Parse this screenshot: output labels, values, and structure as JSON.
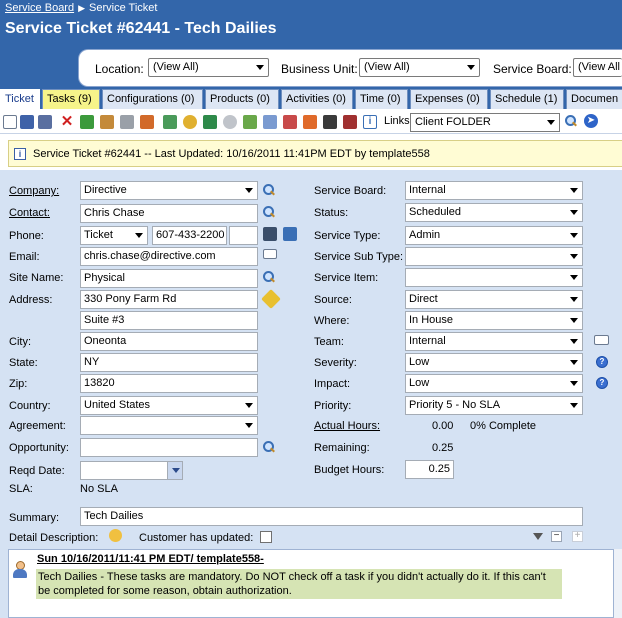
{
  "breadcrumb": {
    "parent": "Service Board",
    "current": "Service Ticket"
  },
  "title": "Service Ticket #62441 - Tech Dailies",
  "filters": {
    "location_label": "Location:",
    "location_value": "(View All)",
    "business_unit_label": "Business Unit:",
    "business_unit_value": "(View All)",
    "service_board_label": "Service Board:",
    "service_board_value": "(View All"
  },
  "tabs": [
    {
      "label": "Ticket"
    },
    {
      "label": "Tasks (9)"
    },
    {
      "label": "Configurations (0)"
    },
    {
      "label": "Products (0)"
    },
    {
      "label": "Activities (0)"
    },
    {
      "label": "Time (0)"
    },
    {
      "label": "Expenses (0)"
    },
    {
      "label": "Schedule (1)"
    },
    {
      "label": "Documen"
    }
  ],
  "toolbar": {
    "links_label": "Links:",
    "links_value": "Client FOLDER"
  },
  "info_message": "Service Ticket #62441 -- Last Updated: 10/16/2011 11:41PM EDT by template558",
  "form": {
    "company_label": "Company:",
    "company_value": "Directive",
    "contact_label": "Contact:",
    "contact_value": "Chris Chase",
    "phone_label": "Phone:",
    "phone_type": "Ticket",
    "phone_number": "607-433-2200",
    "phone_ext": "",
    "email_label": "Email:",
    "email_value": "chris.chase@directive.com",
    "site_label": "Site Name:",
    "site_value": "Physical",
    "address_label": "Address:",
    "address1": "330 Pony Farm Rd",
    "address2": "Suite #3",
    "city_label": "City:",
    "city_value": "Oneonta",
    "state_label": "State:",
    "state_value": "NY",
    "zip_label": "Zip:",
    "zip_value": "13820",
    "country_label": "Country:",
    "country_value": "United States",
    "agreement_label": "Agreement:",
    "agreement_value": "",
    "opportunity_label": "Opportunity:",
    "opportunity_value": "",
    "reqd_date_label": "Reqd Date:",
    "reqd_date_value": "",
    "sla_label": "SLA:",
    "sla_value": "No SLA",
    "service_board_label": "Service Board:",
    "service_board_value": "Internal",
    "status_label": "Status:",
    "status_value": "Scheduled",
    "service_type_label": "Service Type:",
    "service_type_value": "Admin",
    "service_subtype_label": "Service Sub Type:",
    "service_subtype_value": "",
    "service_item_label": "Service Item:",
    "service_item_value": "",
    "source_label": "Source:",
    "source_value": "Direct",
    "where_label": "Where:",
    "where_value": "In House",
    "team_label": "Team:",
    "team_value": "Internal",
    "severity_label": "Severity:",
    "severity_value": "Low",
    "impact_label": "Impact:",
    "impact_value": "Low",
    "priority_label": "Priority:",
    "priority_value": "Priority 5 - No SLA",
    "actual_hours_label": "Actual Hours:",
    "actual_hours_value": "0.00",
    "percent_complete": "0% Complete",
    "remaining_label": "Remaining:",
    "remaining_value": "0.25",
    "budget_hours_label": "Budget Hours:",
    "budget_hours_value": "0.25",
    "summary_label": "Summary:",
    "summary_value": "Tech Dailies",
    "detail_label": "Detail Description:",
    "customer_updated_label": "Customer has updated:"
  },
  "note": {
    "header": "Sun 10/16/2011/11:41 PM EDT/ template558-",
    "body": "Tech Dailies - These tasks are mandatory. Do NOT check off a task if you didn't actually do it. If this can't be completed for some reason, obtain authorization."
  },
  "colors": {
    "header_bg": "#3366aa",
    "form_bg": "#d5e2f3",
    "info_bg": "#fffcd4",
    "tasks_tab": "#f6f48a",
    "note_highlight": "#d6e4b4"
  }
}
